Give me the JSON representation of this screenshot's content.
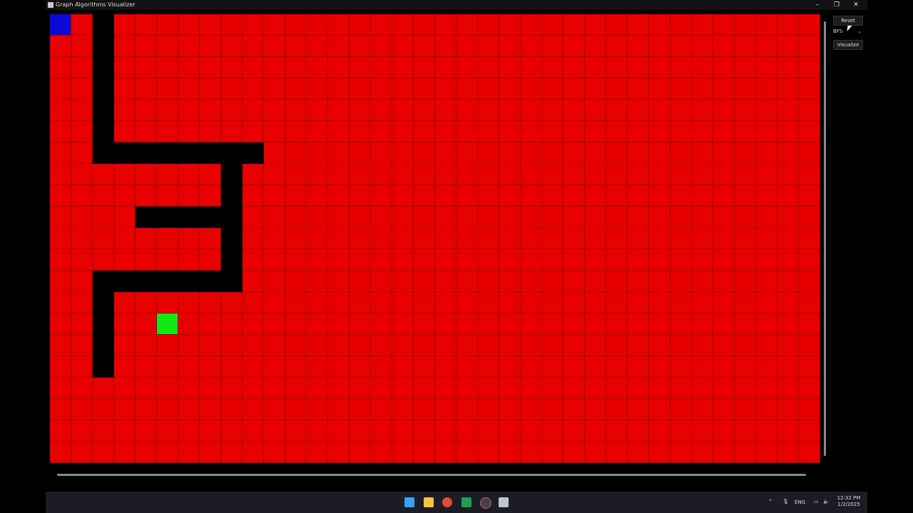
{
  "window": {
    "title": "Graph Algorithms Visualizer",
    "minimize": "–",
    "maximize": "❐",
    "close": "✕"
  },
  "panel": {
    "reset_label": "Reset",
    "algorithm_value": "BFS",
    "visualize_label": "Visualize"
  },
  "grid": {
    "cols": 36,
    "rows": 21,
    "colors": {
      "open": "#e80000",
      "wall": "#000000",
      "start": "#0a0ad8",
      "end": "#12e812"
    },
    "start": [
      0,
      0
    ],
    "end": [
      5,
      14
    ],
    "walls": [
      [
        2,
        0
      ],
      [
        2,
        1
      ],
      [
        2,
        2
      ],
      [
        2,
        3
      ],
      [
        2,
        4
      ],
      [
        2,
        5
      ],
      [
        2,
        6
      ],
      [
        3,
        6
      ],
      [
        4,
        6
      ],
      [
        5,
        6
      ],
      [
        6,
        6
      ],
      [
        7,
        6
      ],
      [
        8,
        6
      ],
      [
        9,
        6
      ],
      [
        8,
        7
      ],
      [
        8,
        8
      ],
      [
        8,
        9
      ],
      [
        8,
        10
      ],
      [
        8,
        11
      ],
      [
        8,
        12
      ],
      [
        4,
        9
      ],
      [
        5,
        9
      ],
      [
        6,
        9
      ],
      [
        7,
        9
      ],
      [
        2,
        12
      ],
      [
        3,
        12
      ],
      [
        4,
        12
      ],
      [
        5,
        12
      ],
      [
        6,
        12
      ],
      [
        7,
        12
      ],
      [
        2,
        13
      ],
      [
        2,
        14
      ],
      [
        2,
        15
      ],
      [
        2,
        16
      ]
    ]
  },
  "taskbar": {
    "icons": [
      "windows-start-icon",
      "file-explorer-icon",
      "chrome-icon",
      "excel-icon",
      "snipping-tool-icon",
      "app-window-icon"
    ],
    "tray": {
      "chevron": "^",
      "lang": "ENG"
    },
    "time": "12:32 PM",
    "date": "1/2/2025"
  }
}
